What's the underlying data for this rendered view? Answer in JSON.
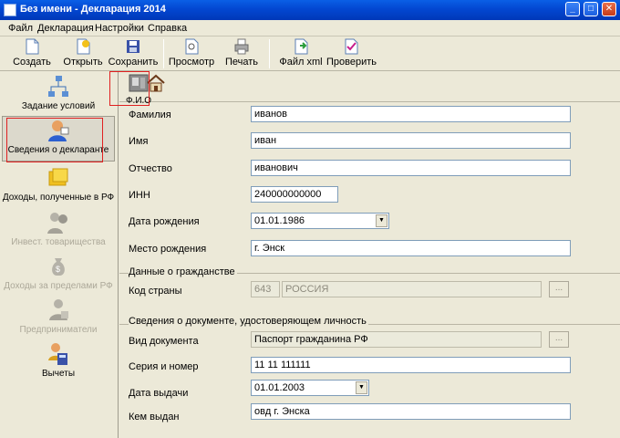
{
  "window": {
    "title": "Без имени - Декларация 2014",
    "minimize": "_",
    "maximize": "□",
    "close": "✕"
  },
  "menu": {
    "file": "Файл",
    "declaration": "Декларация",
    "settings": "Настройки",
    "help": "Справка"
  },
  "toolbar": {
    "create": "Создать",
    "open": "Открыть",
    "save": "Сохранить",
    "preview": "Просмотр",
    "print": "Печать",
    "xml": "Файл xml",
    "check": "Проверить"
  },
  "sidebar": {
    "items": [
      {
        "label": "Задание условий"
      },
      {
        "label": "Сведения о декларанте"
      },
      {
        "label": "Доходы, полученные в РФ"
      },
      {
        "label": "Инвест. товарищества"
      },
      {
        "label": "Доходы за пределами РФ"
      },
      {
        "label": "Предприниматели"
      },
      {
        "label": "Вычеты"
      }
    ]
  },
  "subtabs": {
    "fio": "Ф.И.О"
  },
  "fields": {
    "surname": {
      "label": "Фамилия",
      "value": "иванов"
    },
    "name": {
      "label": "Имя",
      "value": "иван"
    },
    "patronymic": {
      "label": "Отчество",
      "value": "иванович"
    },
    "inn": {
      "label": "ИНН",
      "value": "240000000000"
    },
    "birthdate": {
      "label": "Дата рождения",
      "value": "01.01.1986"
    },
    "birthplace": {
      "label": "Место рождения",
      "value": "г. Энск"
    }
  },
  "citizenship": {
    "title": "Данные о гражданстве",
    "country_label": "Код страны",
    "country_code": "643",
    "country_name": "РОССИЯ",
    "browse": "..."
  },
  "document": {
    "title": "Сведения о документе, удостоверяющем личность",
    "type_label": "Вид документа",
    "type_value": "Паспорт гражданина РФ",
    "browse": "...",
    "series_label": "Серия и номер",
    "series_value": "11 11 111111",
    "issue_date_label": "Дата выдачи",
    "issue_date_value": "01.01.2003",
    "issuer_label": "Кем выдан",
    "issuer_value": "овд г. Энска"
  }
}
